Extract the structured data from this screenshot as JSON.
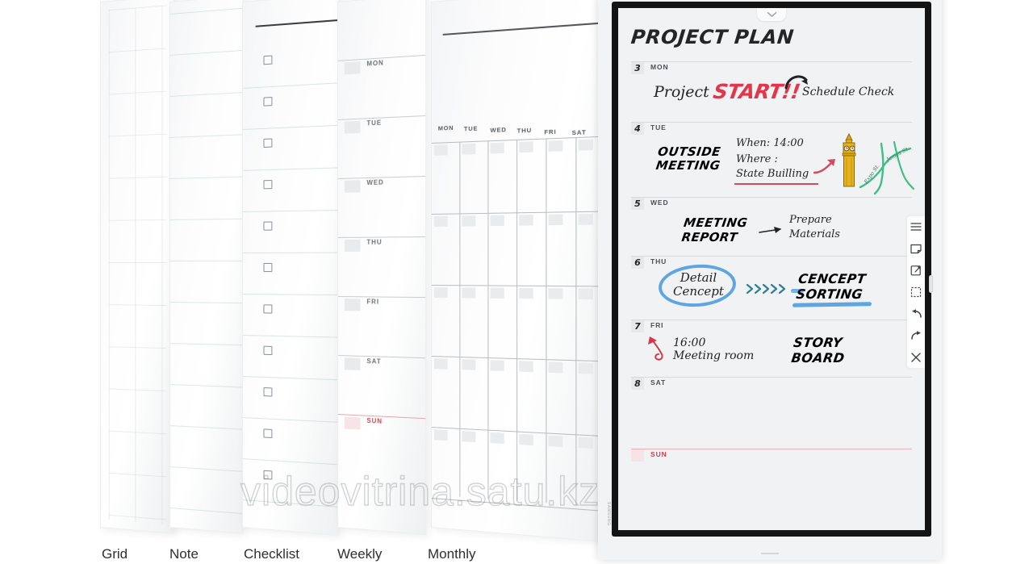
{
  "templates": [
    {
      "id": "grid",
      "label": "Grid"
    },
    {
      "id": "note",
      "label": "Note"
    },
    {
      "id": "checklist",
      "label": "Checklist"
    },
    {
      "id": "weekly",
      "label": "Weekly"
    },
    {
      "id": "monthly",
      "label": "Monthly"
    }
  ],
  "weekly_thumb": {
    "days": [
      "MON",
      "TUE",
      "WED",
      "THU",
      "FRI",
      "SAT",
      "SUN"
    ]
  },
  "monthly_thumb": {
    "days": [
      "MON",
      "TUE",
      "WED",
      "THU",
      "FRI",
      "SAT"
    ]
  },
  "device": {
    "brand": "SAMSUNG",
    "pull_tab_icon": "chevron-down-icon"
  },
  "page": {
    "title": "PROJECT PLAN",
    "rows": [
      {
        "num": "3",
        "day": "MON",
        "notes": {
          "project": "Project",
          "start": "START!!",
          "schedule_check": "Schedule Check"
        }
      },
      {
        "num": "4",
        "day": "TUE",
        "notes": {
          "heading_line1": "OUTSIDE",
          "heading_line2": "MEETING",
          "when": "When: 14:00",
          "where_label": "Where :",
          "where_value": "State Builling",
          "map_label_1": "James St.",
          "map_label_2": "Expo St."
        }
      },
      {
        "num": "5",
        "day": "WED",
        "notes": {
          "heading_line1": "MEETING",
          "heading_line2": "REPORT",
          "follow_line1": "Prepare",
          "follow_line2": "Materials"
        }
      },
      {
        "num": "6",
        "day": "THU",
        "notes": {
          "circled_line1": "Detail",
          "circled_line2": "Cencept",
          "result_line1": "CENCEPT",
          "result_line2": "SORTING"
        }
      },
      {
        "num": "7",
        "day": "FRI",
        "notes": {
          "time": "16:00",
          "place": "Meeting room",
          "heading_line1": "STORY",
          "heading_line2": "BOARD"
        }
      },
      {
        "num": "8",
        "day": "SAT",
        "notes": {}
      },
      {
        "num": "",
        "day": "SUN",
        "notes": {}
      }
    ]
  },
  "toolbar": {
    "items": [
      {
        "id": "menu",
        "icon": "hamburger-menu-icon"
      },
      {
        "id": "note",
        "icon": "sticky-note-icon"
      },
      {
        "id": "export",
        "icon": "export-page-icon"
      },
      {
        "id": "select",
        "icon": "marquee-select-icon"
      },
      {
        "id": "undo",
        "icon": "undo-arrow-icon"
      },
      {
        "id": "redo",
        "icon": "redo-arrow-icon"
      },
      {
        "id": "close",
        "icon": "close-x-icon"
      }
    ]
  },
  "colors": {
    "accent_red": "#e4364a",
    "accent_blue": "#5fa5e2",
    "sunday_red": "#cf3b4a",
    "bigben_gold": "#e8b21f",
    "map_green": "#3fbf87",
    "ink": "#1f2123"
  },
  "watermark": {
    "text": "videovitrina.satu.kz"
  }
}
